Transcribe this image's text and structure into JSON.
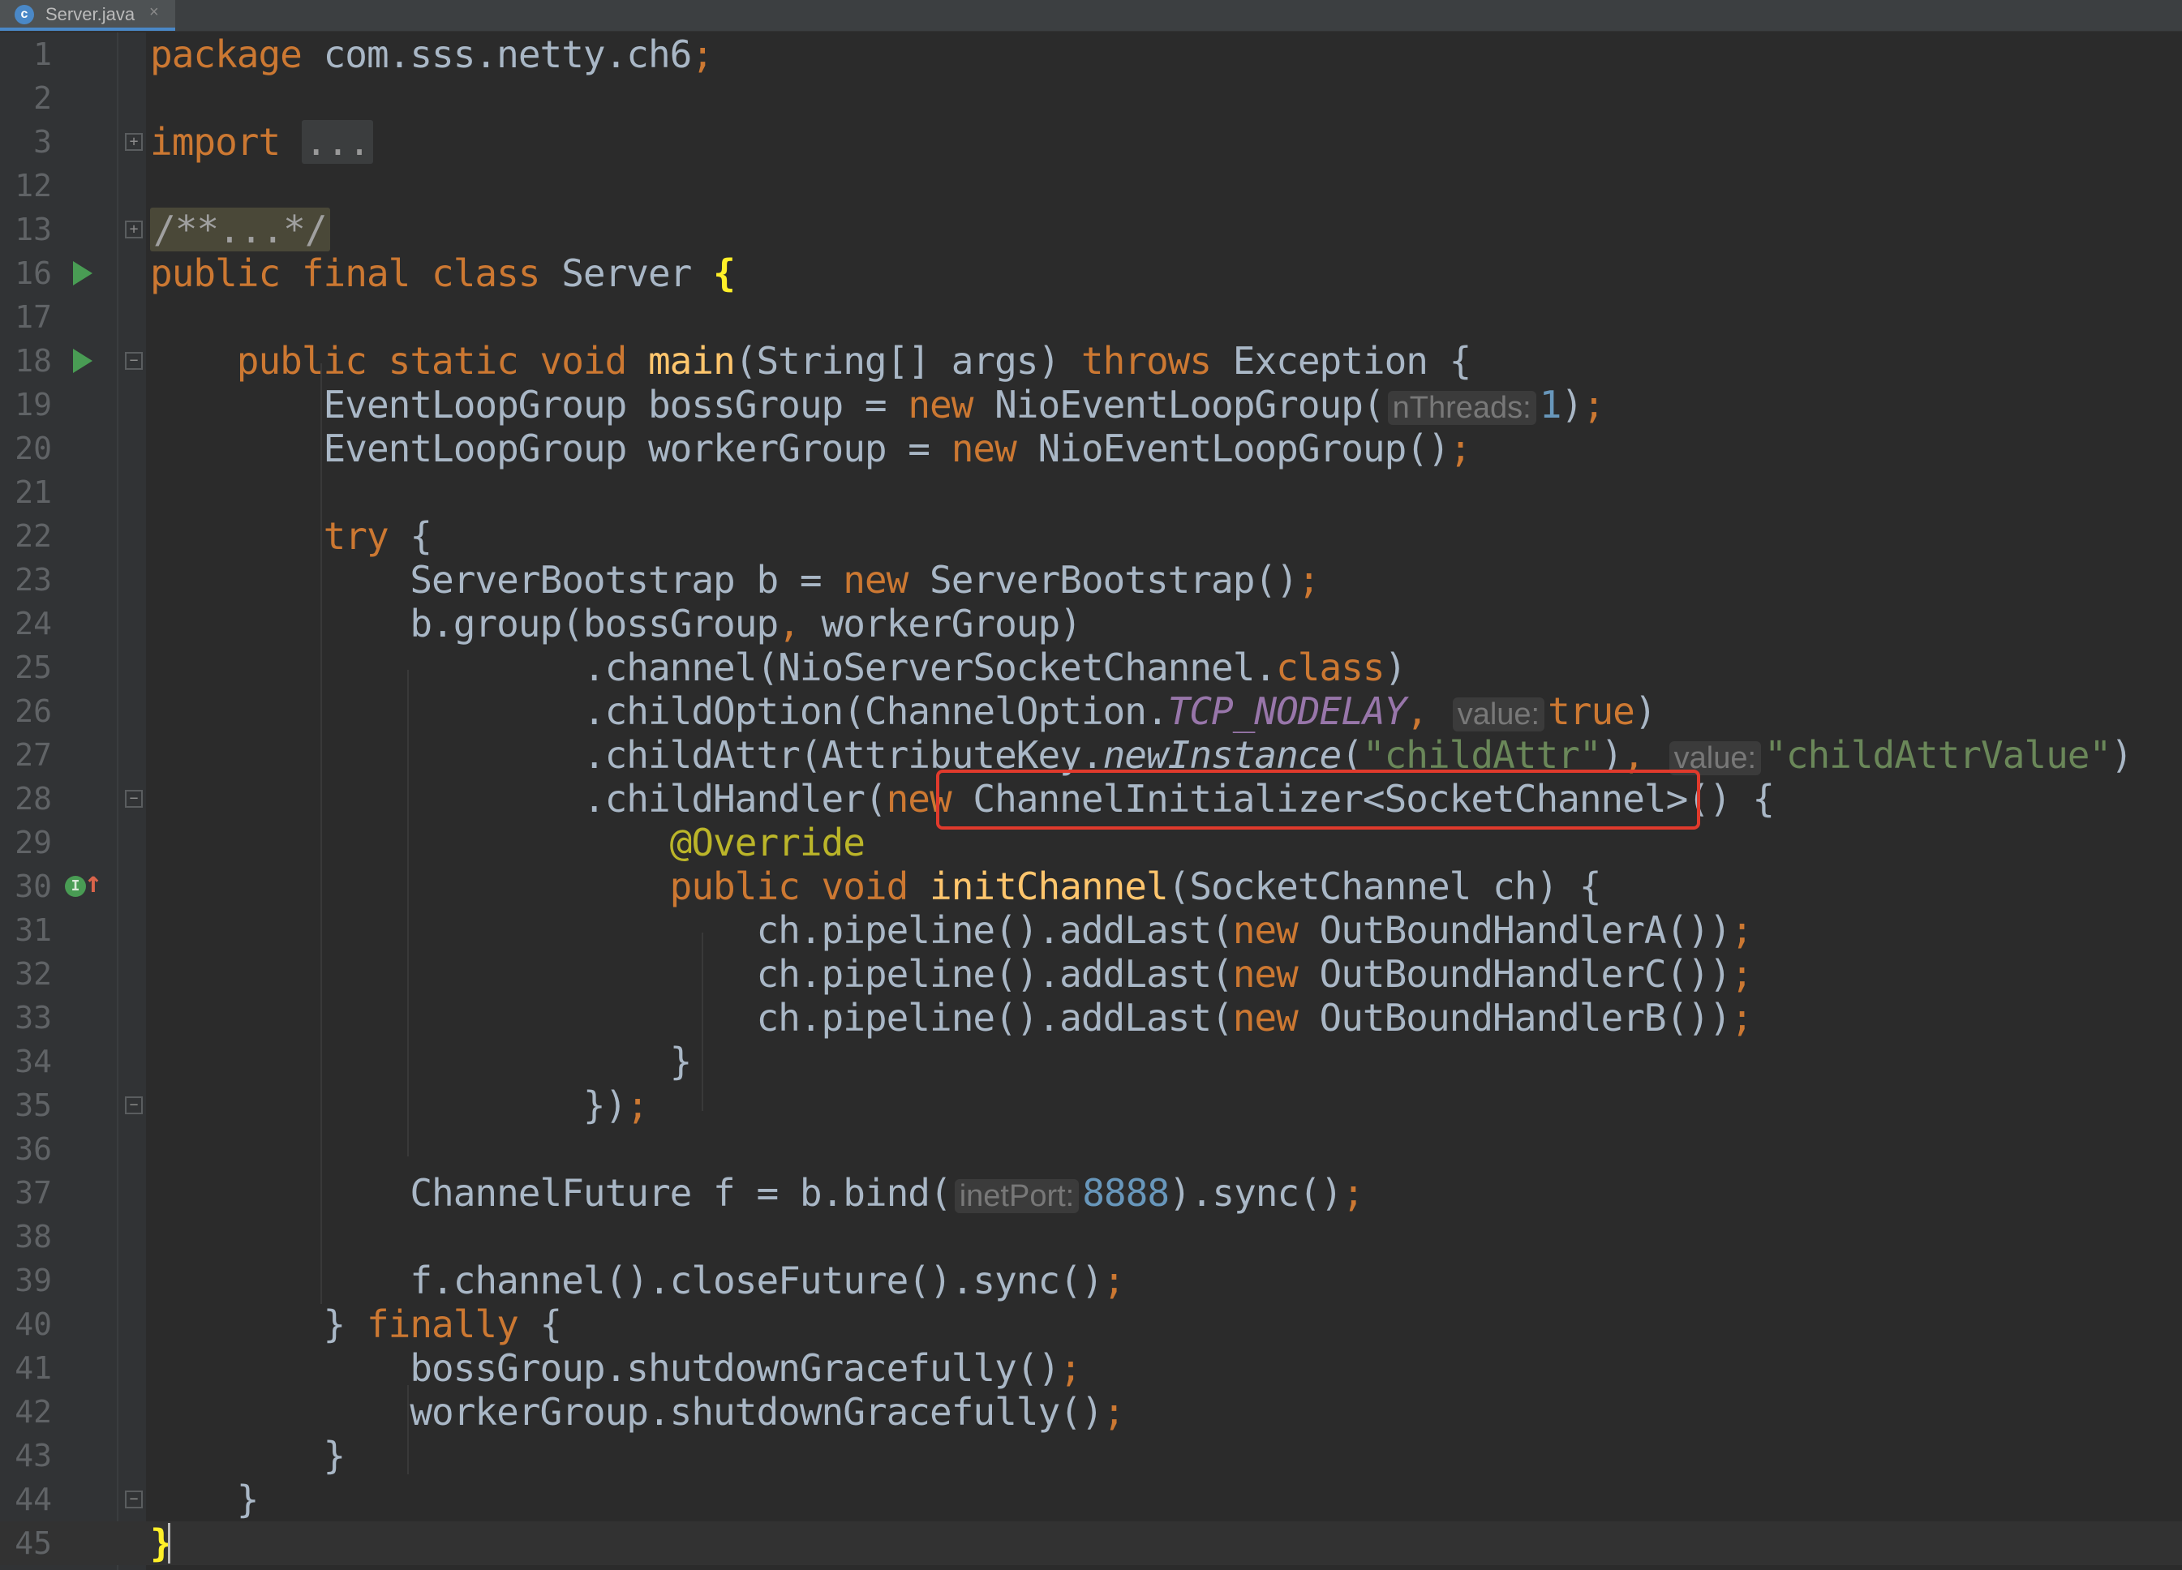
{
  "tab": {
    "icon_name": "java-class-icon",
    "icon_glyph": "c",
    "filename": "Server.java",
    "close_glyph": "×"
  },
  "lines": {
    "l1": {
      "num": "1",
      "t1": "package",
      "t2": " com.sss.netty.ch6",
      "t3": ";"
    },
    "l2": {
      "num": "2"
    },
    "l3": {
      "num": "3",
      "t1": "import",
      "t2": " ",
      "t3": "..."
    },
    "l12": {
      "num": "12"
    },
    "l13": {
      "num": "13",
      "t1": "/**...*/"
    },
    "l16": {
      "num": "16",
      "t1": "public final class",
      "t2": " Server ",
      "t3": "{"
    },
    "l17": {
      "num": "17"
    },
    "l18": {
      "num": "18",
      "t1": "    public static void",
      "t2": " ",
      "t3": "main",
      "t4": "(String[] args) ",
      "t5": "throws",
      "t6": " Exception {"
    },
    "l19": {
      "num": "19",
      "t1": "        EventLoopGroup bossGroup = ",
      "t2": "new",
      "t3": " NioEventLoopGroup(",
      "hint": "nThreads:",
      "t4": "1",
      "t5": ")",
      "t6": ";"
    },
    "l20": {
      "num": "20",
      "t1": "        EventLoopGroup workerGroup = ",
      "t2": "new",
      "t3": " NioEventLoopGroup()",
      "t4": ";"
    },
    "l21": {
      "num": "21"
    },
    "l22": {
      "num": "22",
      "t1": "        ",
      "t2": "try",
      "t3": " {"
    },
    "l23": {
      "num": "23",
      "t1": "            ServerBootstrap b = ",
      "t2": "new",
      "t3": " ServerBootstrap()",
      "t4": ";"
    },
    "l24": {
      "num": "24",
      "t1": "            b.group(bossGroup",
      "t2": ",",
      "t3": " workerGroup)"
    },
    "l25": {
      "num": "25",
      "t1": "                    .channel(NioServerSocketChannel.",
      "t2": "class",
      "t3": ")"
    },
    "l26": {
      "num": "26",
      "t1": "                    .childOption(ChannelOption.",
      "t2": "TCP_NODELAY",
      "t3": ",",
      "hint": "value:",
      "t4": "true",
      "t5": ")"
    },
    "l27": {
      "num": "27",
      "t1": "                    .childAttr(AttributeKey.",
      "t2": "newInstance",
      "t3": "(",
      "t4": "\"childAttr\"",
      "t5": ")",
      "t6": ",",
      "hint": "value:",
      "t7": "\"childAttrValue\"",
      "t8": ")"
    },
    "l28": {
      "num": "28",
      "t1": "                    .childHandler(",
      "t2": "new",
      "t3": " ChannelInitializer<SocketChannel>() {"
    },
    "l29": {
      "num": "29",
      "t1": "                        ",
      "t2": "@Override"
    },
    "l30": {
      "num": "30",
      "t1": "                        ",
      "t2": "public void",
      "t3": " ",
      "t4": "initChannel",
      "t5": "(SocketChannel ch) {"
    },
    "l31": {
      "num": "31",
      "t1": "                            ch.pipeline().addLast(",
      "t2": "new",
      "t3": " OutBoundHandlerA())",
      "t4": ";"
    },
    "l32": {
      "num": "32",
      "t1": "                            ch.pipeline().addLast(",
      "t2": "new",
      "t3": " OutBoundHandlerC())",
      "t4": ";"
    },
    "l33": {
      "num": "33",
      "t1": "                            ch.pipeline().addLast(",
      "t2": "new",
      "t3": " OutBoundHandlerB())",
      "t4": ";"
    },
    "l34": {
      "num": "34",
      "t1": "                        }"
    },
    "l35": {
      "num": "35",
      "t1": "                    })",
      "t2": ";"
    },
    "l36": {
      "num": "36"
    },
    "l37": {
      "num": "37",
      "t1": "            ChannelFuture f = b.bind(",
      "hint": "inetPort:",
      "t2": "8888",
      "t3": ").sync()",
      "t4": ";"
    },
    "l38": {
      "num": "38"
    },
    "l39": {
      "num": "39",
      "t1": "            f.channel().closeFuture().sync()",
      "t2": ";"
    },
    "l40": {
      "num": "40",
      "t1": "        } ",
      "t2": "finally",
      "t3": " {"
    },
    "l41": {
      "num": "41",
      "t1": "            bossGroup.shutdownGracefully()",
      "t2": ";"
    },
    "l42": {
      "num": "42",
      "t1": "            workerGroup.shutdownGracefully()",
      "t2": ";"
    },
    "l43": {
      "num": "43",
      "t1": "        }"
    },
    "l44": {
      "num": "44",
      "t1": "    }"
    },
    "l45": {
      "num": "45",
      "t1": "}"
    }
  },
  "gutter_icons": {
    "run": "run-icon",
    "fold": "fold-icon",
    "implements": "implements-method-icon",
    "implements_glyph": "I",
    "up_arrow_glyph": "↑",
    "fold_plus": "+",
    "fold_minus": "−"
  },
  "colors": {
    "background": "#2b2b2b",
    "keyword": "#cc7832",
    "function": "#ffc66d",
    "string": "#6a8759",
    "number": "#6897bb",
    "highlight_box": "#e03a2c"
  }
}
